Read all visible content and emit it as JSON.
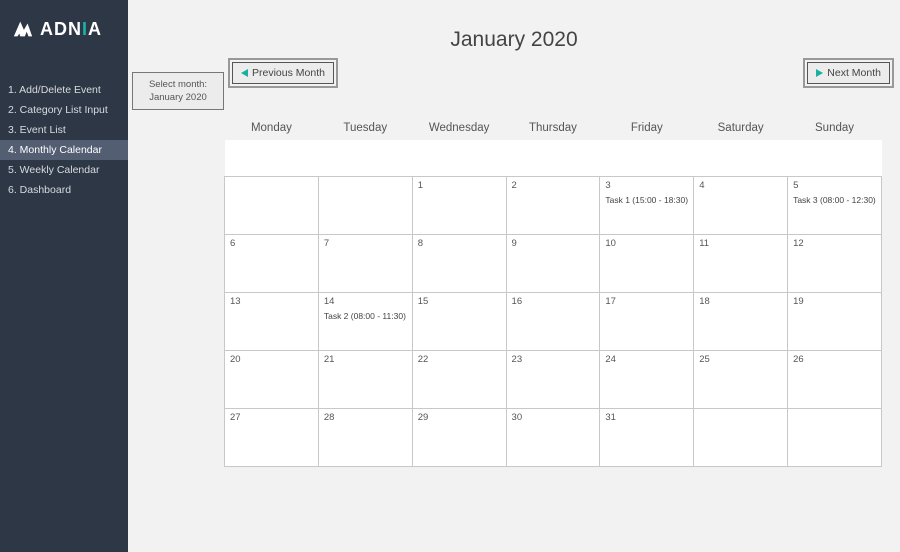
{
  "brand": {
    "name_a": "ADN",
    "name_b": "I",
    "name_c": "A"
  },
  "sidebar": {
    "items": [
      {
        "label": "1. Add/Delete Event",
        "active": false
      },
      {
        "label": "2. Category List Input",
        "active": false
      },
      {
        "label": "3. Event List",
        "active": false
      },
      {
        "label": "4. Monthly Calendar",
        "active": true
      },
      {
        "label": "5. Weekly Calendar",
        "active": false
      },
      {
        "label": "6. Dashboard",
        "active": false
      }
    ]
  },
  "header": {
    "title": "January 2020",
    "select_month_label": "Select month:",
    "select_month_value": "January 2020",
    "prev_label": "Previous Month",
    "next_label": "Next Month"
  },
  "calendar": {
    "day_names": [
      "Monday",
      "Tuesday",
      "Wednesday",
      "Thursday",
      "Friday",
      "Saturday",
      "Sunday"
    ],
    "weeks": [
      [
        {
          "day": "",
          "events": []
        },
        {
          "day": "",
          "events": []
        },
        {
          "day": "1",
          "events": []
        },
        {
          "day": "2",
          "events": []
        },
        {
          "day": "3",
          "events": [
            "Task 1 (15:00 - 18:30)"
          ]
        },
        {
          "day": "4",
          "events": []
        },
        {
          "day": "5",
          "events": [
            "Task 3 (08:00 - 12:30)"
          ]
        }
      ],
      [
        {
          "day": "6",
          "events": []
        },
        {
          "day": "7",
          "events": []
        },
        {
          "day": "8",
          "events": []
        },
        {
          "day": "9",
          "events": []
        },
        {
          "day": "10",
          "events": []
        },
        {
          "day": "11",
          "events": []
        },
        {
          "day": "12",
          "events": []
        }
      ],
      [
        {
          "day": "13",
          "events": []
        },
        {
          "day": "14",
          "events": [
            "Task 2 (08:00 - 11:30)"
          ]
        },
        {
          "day": "15",
          "events": []
        },
        {
          "day": "16",
          "events": []
        },
        {
          "day": "17",
          "events": []
        },
        {
          "day": "18",
          "events": []
        },
        {
          "day": "19",
          "events": []
        }
      ],
      [
        {
          "day": "20",
          "events": []
        },
        {
          "day": "21",
          "events": []
        },
        {
          "day": "22",
          "events": []
        },
        {
          "day": "23",
          "events": []
        },
        {
          "day": "24",
          "events": []
        },
        {
          "day": "25",
          "events": []
        },
        {
          "day": "26",
          "events": []
        }
      ],
      [
        {
          "day": "27",
          "events": []
        },
        {
          "day": "28",
          "events": []
        },
        {
          "day": "29",
          "events": []
        },
        {
          "day": "30",
          "events": []
        },
        {
          "day": "31",
          "events": []
        },
        {
          "day": "",
          "events": []
        },
        {
          "day": "",
          "events": []
        }
      ]
    ]
  }
}
